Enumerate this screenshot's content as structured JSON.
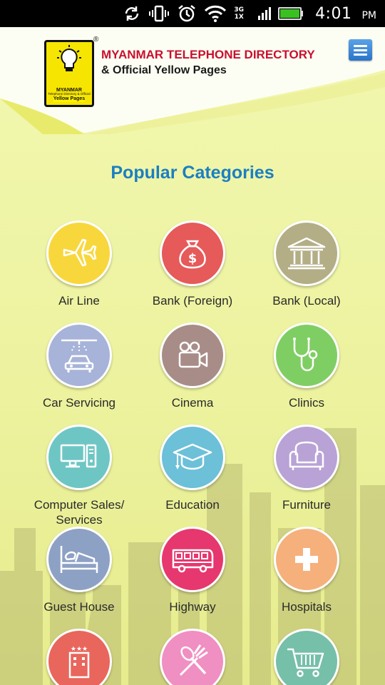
{
  "status_bar": {
    "time": "4:01",
    "ampm": "PM",
    "network": "3G",
    "network2": "1X",
    "signal_label": "2"
  },
  "header": {
    "logo": {
      "line1": "MYANMAR",
      "line2": "Telephone Directory & Official",
      "line3": "Yellow Pages",
      "registered": "®"
    },
    "title": "MYANMAR TELEPHONE DIRECTORY",
    "subtitle": "& Official Yellow Pages",
    "menu_icon": "hamburger-icon"
  },
  "section_title": "Popular Categories",
  "categories": [
    {
      "label": "Air Line",
      "icon": "airplane-icon",
      "color": "#f8d73c"
    },
    {
      "label": "Bank (Foreign)",
      "icon": "money-bag-icon",
      "color": "#e65a5a"
    },
    {
      "label": "Bank (Local)",
      "icon": "bank-building-icon",
      "color": "#b3ae86"
    },
    {
      "label": "Car Servicing",
      "icon": "car-wash-icon",
      "color": "#a7b3d8"
    },
    {
      "label": "Cinema",
      "icon": "video-camera-icon",
      "color": "#a88c88"
    },
    {
      "label": "Clinics",
      "icon": "stethoscope-icon",
      "color": "#7fce63"
    },
    {
      "label": "Computer Sales/",
      "label2": "Services",
      "icon": "computer-icon",
      "color": "#6ec6c4"
    },
    {
      "label": "Education",
      "icon": "graduation-cap-icon",
      "color": "#6cc0d8"
    },
    {
      "label": "Furniture",
      "icon": "armchair-icon",
      "color": "#b9a2d6"
    },
    {
      "label": "Guest House",
      "icon": "bed-icon",
      "color": "#8da1c4"
    },
    {
      "label": "Highway",
      "icon": "bus-icon",
      "color": "#e6386e"
    },
    {
      "label": "Hospitals",
      "icon": "plus-icon",
      "color": "#f6b07c"
    },
    {
      "label": "",
      "icon": "hotel-icon",
      "color": "#e8665c"
    },
    {
      "label": "",
      "icon": "restaurant-icon",
      "color": "#f08fc2"
    },
    {
      "label": "",
      "icon": "shopping-cart-icon",
      "color": "#76bfa9"
    }
  ]
}
